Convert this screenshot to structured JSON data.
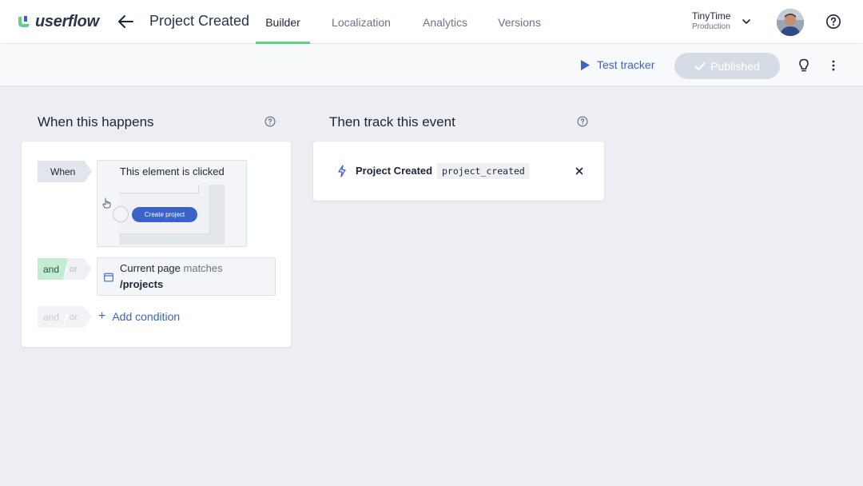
{
  "header": {
    "logo_text": "userflow",
    "project_title": "Project Created",
    "tabs": [
      {
        "label": "Builder",
        "active": true
      },
      {
        "label": "Localization",
        "active": false
      },
      {
        "label": "Analytics",
        "active": false
      },
      {
        "label": "Versions",
        "active": false
      }
    ],
    "workspace": {
      "name": "TinyTime",
      "environment": "Production"
    },
    "icons": {
      "back": "arrow-left-icon",
      "help": "question-circle-icon",
      "dropdown": "chevron-down-icon"
    }
  },
  "toolbar": {
    "test_tracker_label": "Test tracker",
    "published_label": "Published",
    "icons": {
      "play": "play-icon",
      "check": "check-icon",
      "bulb": "lightbulb-icon",
      "more": "kebab-icon"
    }
  },
  "trigger_section": {
    "title": "When this happens",
    "when_label": "When",
    "trigger": {
      "title": "This element is clicked",
      "preview_button_label": "Create project"
    },
    "condition_connector": {
      "and": "and",
      "or": "or",
      "selected": "and"
    },
    "condition": {
      "subject": "Current page",
      "operator": "matches",
      "value": "/projects"
    },
    "add_connector": {
      "and": "and",
      "or": "or"
    },
    "add_condition_label": "Add condition"
  },
  "event_section": {
    "title": "Then track this event",
    "event": {
      "name": "Project Created",
      "code": "project_created"
    }
  },
  "colors": {
    "accent": "#3a63c8",
    "tab_underline": "#5fd18d",
    "and_selected_bg": "#c3ecd2",
    "published_bg": "#d6dce5",
    "page_bg": "#eceef3"
  }
}
